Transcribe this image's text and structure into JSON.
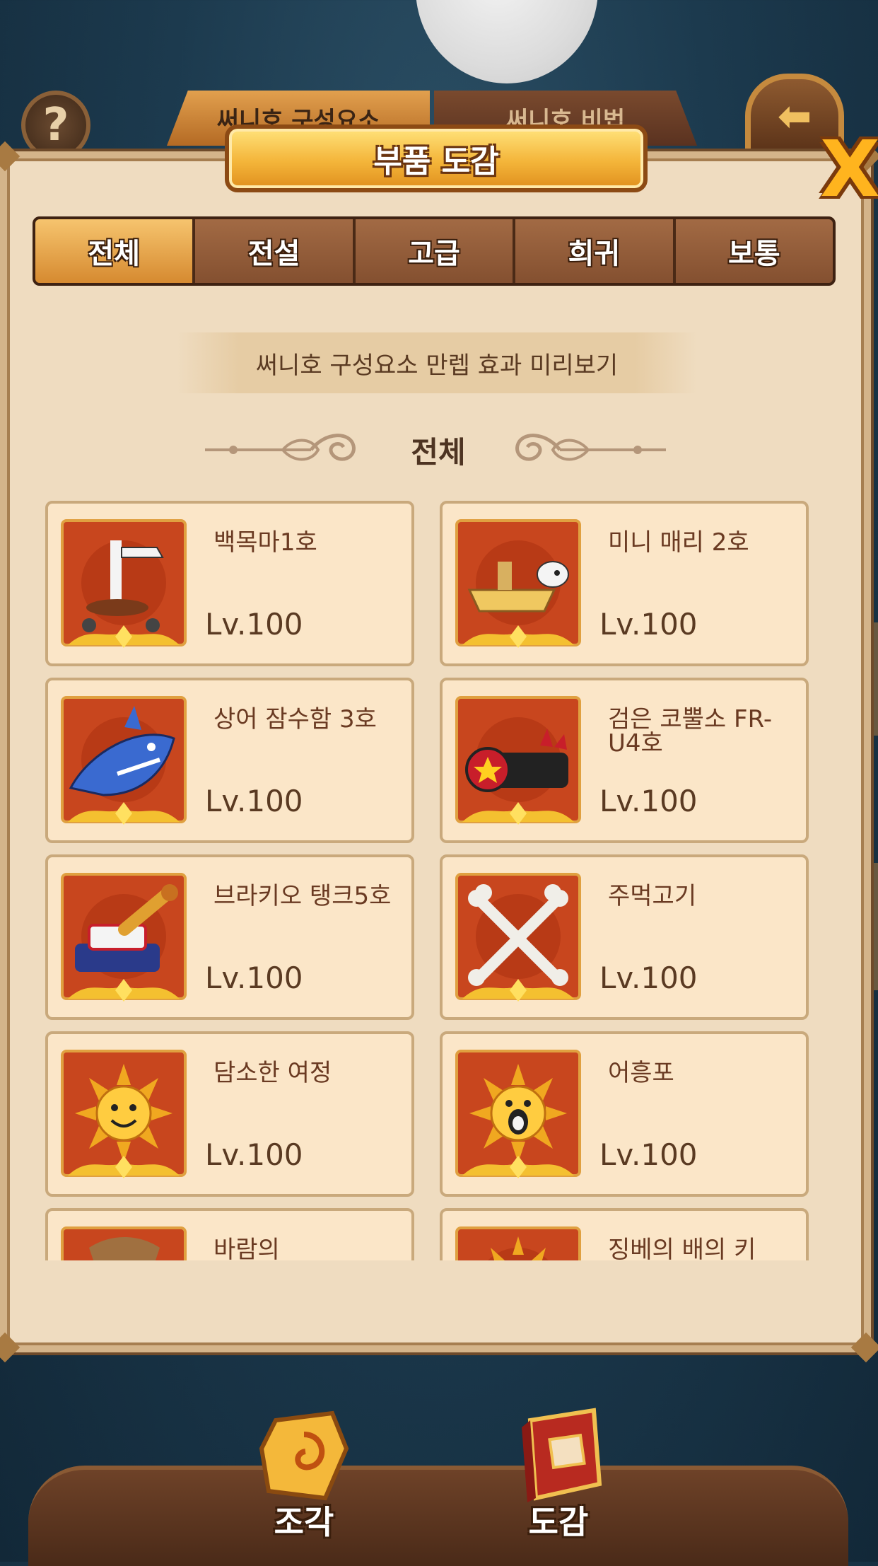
{
  "background": {
    "tabs": [
      "써니호 구성요소",
      "써니호 비법"
    ]
  },
  "dialog": {
    "title": "부품 도감",
    "preview_label": "써니호 구성요소 만렙 효과 미리보기",
    "section_title": "전체"
  },
  "tabs": [
    {
      "label": "전체",
      "active": true
    },
    {
      "label": "전설",
      "active": false
    },
    {
      "label": "고급",
      "active": false
    },
    {
      "label": "희귀",
      "active": false
    },
    {
      "label": "보통",
      "active": false
    }
  ],
  "items": [
    {
      "name": "백목마1호",
      "level": "Lv.100",
      "icon": "white-horse-icon"
    },
    {
      "name": "미니 매리 2호",
      "level": "Lv.100",
      "icon": "mini-merry-icon"
    },
    {
      "name": "상어 잠수함 3호",
      "level": "Lv.100",
      "icon": "shark-submarine-icon"
    },
    {
      "name": "검은 코뿔소 FR-U4호",
      "level": "Lv.100",
      "icon": "black-rhino-icon"
    },
    {
      "name": "브라키오 탱크5호",
      "level": "Lv.100",
      "icon": "brachio-tank-icon"
    },
    {
      "name": "주먹고기",
      "level": "Lv.100",
      "icon": "crossed-bones-icon"
    },
    {
      "name": "담소한 여정",
      "level": "Lv.100",
      "icon": "sunny-lion-icon"
    },
    {
      "name": "어흥포",
      "level": "Lv.100",
      "icon": "roaring-lion-icon"
    },
    {
      "name": "바람의",
      "level": "",
      "icon": "partial-item-icon"
    },
    {
      "name": "징베의 배의 키",
      "level": "",
      "icon": "partial-item-icon"
    }
  ],
  "bottom_nav": [
    {
      "label": "조각",
      "icon": "fragment-icon"
    },
    {
      "label": "도감",
      "icon": "encyclopedia-book-icon"
    }
  ],
  "colors": {
    "panel": "#efdcc0",
    "card": "#fbe6c8",
    "accent_orange": "#f4b53a",
    "icon_bg": "#c8461e",
    "text_brown": "#6a3a22"
  }
}
